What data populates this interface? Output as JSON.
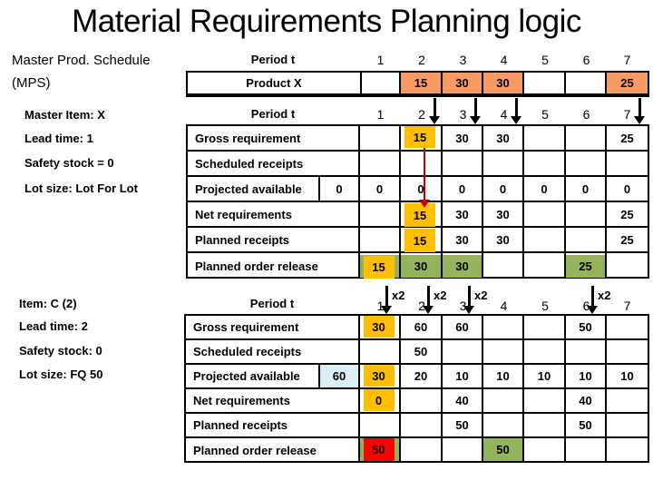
{
  "title": "Material Requirements Planning logic",
  "colors": {
    "mps_cell": "#f79a64",
    "highlight_orange": "#ffbf00",
    "planned_release_green": "#93b35c",
    "highlight_red": "#ff0000",
    "initial_inventory_blue": "#dbeef4",
    "flow_arrow": "#c00000"
  },
  "mps": {
    "label_line1": "Master Prod. Schedule",
    "label_line2": "(MPS)",
    "period_header": "Period t",
    "periods": [
      "1",
      "2",
      "3",
      "4",
      "5",
      "6",
      "7"
    ],
    "row_label": "Product X",
    "values": [
      "",
      "15",
      "30",
      "30",
      "",
      "",
      "25"
    ]
  },
  "item_x": {
    "info": [
      "Master Item: X",
      "Lead time: 1",
      "Safety stock = 0",
      "Lot size: Lot For Lot"
    ],
    "period_header": "Period t",
    "periods": [
      "1",
      "2",
      "3",
      "4",
      "5",
      "6",
      "7"
    ],
    "initial_projected": "0",
    "rows": [
      {
        "label": "Gross requirement",
        "values": [
          "",
          "15",
          "30",
          "30",
          "",
          "",
          "25"
        ]
      },
      {
        "label": "Scheduled receipts",
        "values": [
          "",
          "",
          "",
          "",
          "",
          "",
          ""
        ]
      },
      {
        "label": "Projected available",
        "values": [
          "0",
          "0",
          "0",
          "0",
          "0",
          "0",
          "0"
        ]
      },
      {
        "label": "Net requirements",
        "values": [
          "",
          "15",
          "30",
          "30",
          "",
          "",
          "25"
        ]
      },
      {
        "label": "Planned receipts",
        "values": [
          "",
          "15",
          "30",
          "30",
          "",
          "",
          "25"
        ]
      },
      {
        "label": "Planned order release",
        "values": [
          "15",
          "30",
          "30",
          "",
          "",
          "25",
          ""
        ]
      }
    ]
  },
  "item_c": {
    "info": [
      "Item: C (2)",
      "Lead time: 2",
      "Safety stock: 0",
      "Lot size: FQ 50"
    ],
    "period_header": "Period t",
    "periods": [
      "1",
      "2",
      "3",
      "4",
      "5",
      "6",
      "7"
    ],
    "multiplier_label": "x2",
    "initial_projected": "60",
    "rows": [
      {
        "label": "Gross requirement",
        "values": [
          "30",
          "60",
          "60",
          "",
          "",
          "50",
          ""
        ]
      },
      {
        "label": "Scheduled receipts",
        "values": [
          "",
          "50",
          "",
          "",
          "",
          "",
          ""
        ]
      },
      {
        "label": "Projected available",
        "values": [
          "30",
          "20",
          "10",
          "10",
          "10",
          "10",
          "10"
        ]
      },
      {
        "label": "Net requirements",
        "values": [
          "0",
          "",
          "40",
          "",
          "",
          "40",
          ""
        ]
      },
      {
        "label": "Planned receipts",
        "values": [
          "",
          "",
          "50",
          "",
          "",
          "50",
          ""
        ]
      },
      {
        "label": "Planned order release",
        "values": [
          "50",
          "",
          "",
          "50",
          "",
          "",
          ""
        ]
      }
    ]
  }
}
